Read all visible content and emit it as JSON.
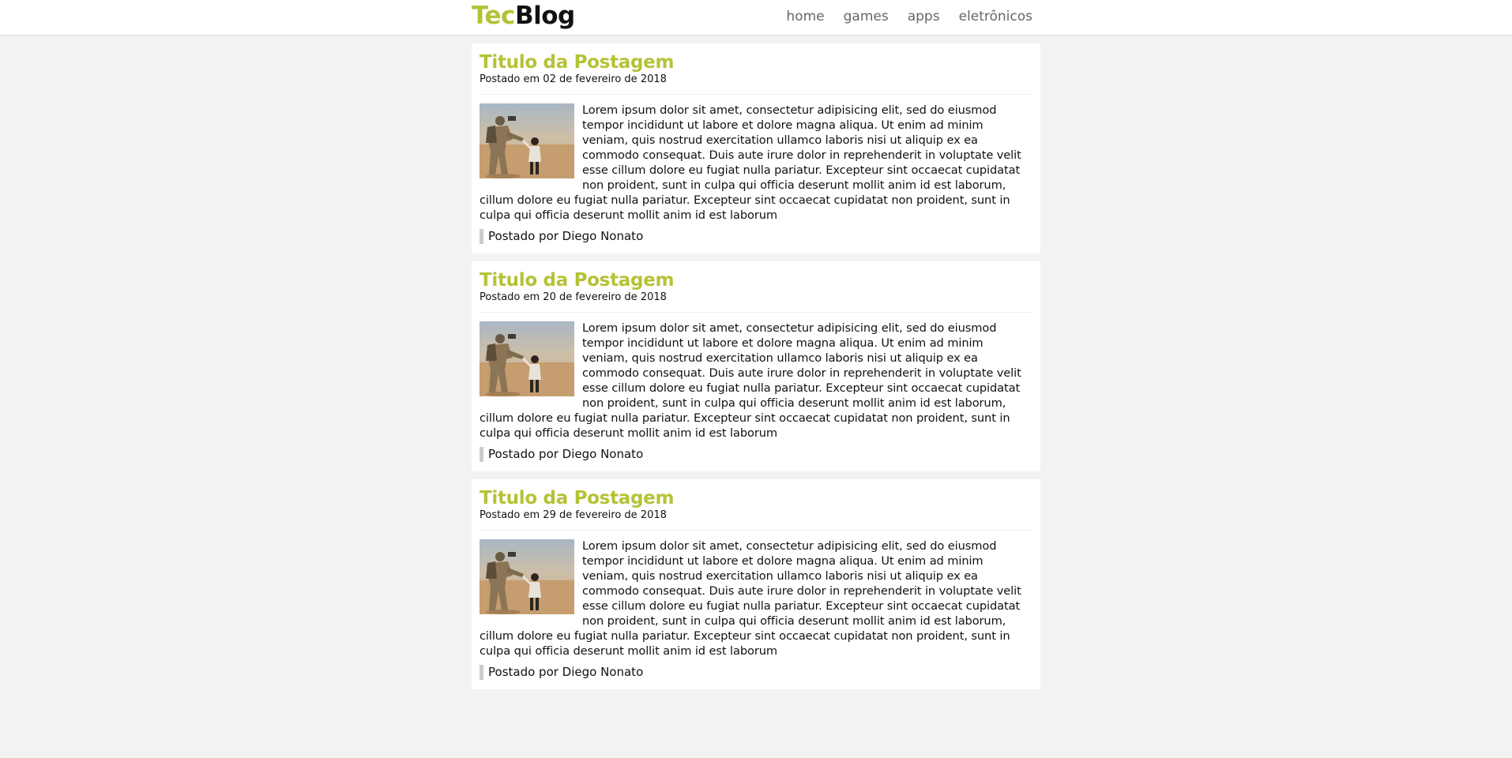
{
  "colors": {
    "accent": "#b5c236"
  },
  "header": {
    "logo_part1": "Tec",
    "logo_part2": "Blog",
    "nav": [
      {
        "label": "home"
      },
      {
        "label": "games"
      },
      {
        "label": "apps"
      },
      {
        "label": "eletrônicos"
      }
    ]
  },
  "posts": [
    {
      "title": "Titulo da Postagem",
      "date": "Postado em 02 de fevereiro de 2018",
      "image_icon": "soldier-child-photo",
      "text": "Lorem ipsum dolor sit amet, consectetur adipisicing elit, sed do eiusmod tempor incididunt ut labore et dolore magna aliqua. Ut enim ad minim veniam, quis nostrud exercitation ullamco laboris nisi ut aliquip ex ea commodo consequat. Duis aute irure dolor in reprehenderit in voluptate velit esse cillum dolore eu fugiat nulla pariatur. Excepteur sint occaecat cupidatat non proident, sunt in culpa qui officia deserunt mollit anim id est laborum, cillum dolore eu fugiat nulla pariatur. Excepteur sint occaecat cupidatat non proident, sunt in culpa qui officia deserunt mollit anim id est laborum",
      "author": "Postado por Diego Nonato"
    },
    {
      "title": "Titulo da Postagem",
      "date": "Postado em 20 de fevereiro de 2018",
      "image_icon": "soldier-child-photo",
      "text": "Lorem ipsum dolor sit amet, consectetur adipisicing elit, sed do eiusmod tempor incididunt ut labore et dolore magna aliqua. Ut enim ad minim veniam, quis nostrud exercitation ullamco laboris nisi ut aliquip ex ea commodo consequat. Duis aute irure dolor in reprehenderit in voluptate velit esse cillum dolore eu fugiat nulla pariatur. Excepteur sint occaecat cupidatat non proident, sunt in culpa qui officia deserunt mollit anim id est laborum, cillum dolore eu fugiat nulla pariatur. Excepteur sint occaecat cupidatat non proident, sunt in culpa qui officia deserunt mollit anim id est laborum",
      "author": "Postado por Diego Nonato"
    },
    {
      "title": "Titulo da Postagem",
      "date": "Postado em 29 de fevereiro de 2018",
      "image_icon": "soldier-child-photo",
      "text": "Lorem ipsum dolor sit amet, consectetur adipisicing elit, sed do eiusmod tempor incididunt ut labore et dolore magna aliqua. Ut enim ad minim veniam, quis nostrud exercitation ullamco laboris nisi ut aliquip ex ea commodo consequat. Duis aute irure dolor in reprehenderit in voluptate velit esse cillum dolore eu fugiat nulla pariatur. Excepteur sint occaecat cupidatat non proident, sunt in culpa qui officia deserunt mollit anim id est laborum, cillum dolore eu fugiat nulla pariatur. Excepteur sint occaecat cupidatat non proident, sunt in culpa qui officia deserunt mollit anim id est laborum",
      "author": "Postado por Diego Nonato"
    }
  ]
}
